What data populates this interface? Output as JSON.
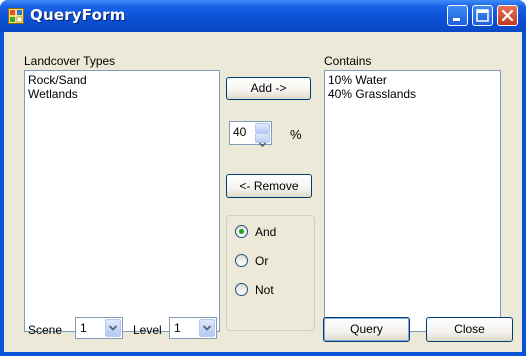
{
  "window": {
    "title": "QueryForm"
  },
  "landcover": {
    "label": "Landcover Types",
    "items": [
      "Rock/Sand",
      "Wetlands"
    ]
  },
  "contains": {
    "label": "Contains",
    "items": [
      "10% Water",
      "40% Grasslands"
    ]
  },
  "buttons": {
    "add": "Add ->",
    "remove": "<- Remove",
    "query": "Query",
    "close": "Close"
  },
  "percent": {
    "value": "40",
    "unit": "%"
  },
  "logic": {
    "options": [
      "And",
      "Or",
      "Not"
    ],
    "selected": "And"
  },
  "scene": {
    "label": "Scene",
    "value": "1"
  },
  "level": {
    "label": "Level",
    "value": "1"
  },
  "colors": {
    "titlebar": "#0a53d8",
    "client": "#ece9d8",
    "radio_selected": "#21a121"
  },
  "icons": {
    "app": "app-form-icon",
    "minimize": "minimize-icon",
    "maximize": "maximize-icon",
    "close": "close-icon",
    "spin_up": "chevron-up-icon",
    "spin_down": "chevron-down-icon",
    "dropdown": "chevron-down-icon"
  }
}
